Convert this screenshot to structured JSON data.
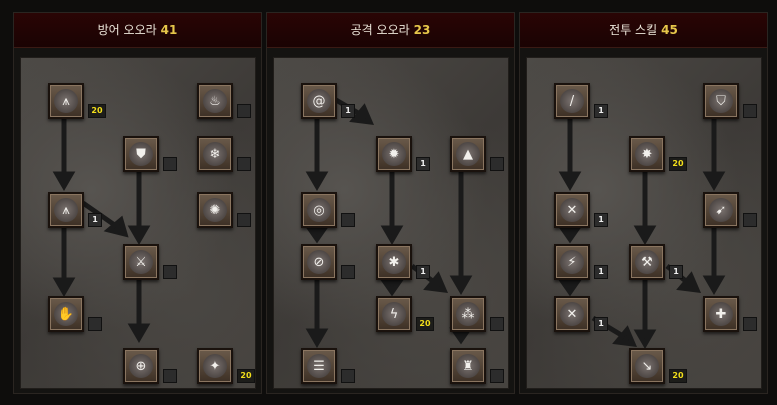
{
  "panels": [
    {
      "title": "방어 오오라",
      "points": "41",
      "nodes": [
        {
          "id": "d1",
          "icon": "claw-icon",
          "glyph": "⩚",
          "level": "20",
          "max": true
        },
        {
          "id": "d2",
          "icon": "wild-icon",
          "glyph": "♨",
          "level": "",
          "max": false
        },
        {
          "id": "d3",
          "icon": "shield-icon",
          "glyph": "⛊",
          "level": "",
          "max": false
        },
        {
          "id": "d4",
          "icon": "snowflake-icon",
          "glyph": "❄",
          "level": "",
          "max": false
        },
        {
          "id": "d5",
          "icon": "double-claw-icon",
          "glyph": "⩚",
          "level": "1",
          "max": false
        },
        {
          "id": "d6",
          "icon": "blade-icon",
          "glyph": "⚔",
          "level": "",
          "max": false
        },
        {
          "id": "d7",
          "icon": "swirl-icon",
          "glyph": "✺",
          "level": "",
          "max": false
        },
        {
          "id": "d8",
          "icon": "flame-hand-icon",
          "glyph": "✋",
          "level": "",
          "max": false
        },
        {
          "id": "d9",
          "icon": "target-icon",
          "glyph": "⊕",
          "level": "",
          "max": false
        },
        {
          "id": "d10",
          "icon": "compass-icon",
          "glyph": "✦",
          "level": "20",
          "max": true
        }
      ]
    },
    {
      "title": "공격 오오라",
      "points": "23",
      "nodes": [
        {
          "id": "o1",
          "icon": "spiral-icon",
          "glyph": "@",
          "level": "1",
          "max": false
        },
        {
          "id": "o2",
          "icon": "sun-blade-icon",
          "glyph": "✹",
          "level": "1",
          "max": false
        },
        {
          "id": "o3",
          "icon": "pyramid-icon",
          "glyph": "▲",
          "level": "",
          "max": false
        },
        {
          "id": "o4",
          "icon": "rings-icon",
          "glyph": "◎",
          "level": "",
          "max": false
        },
        {
          "id": "o5",
          "icon": "slash-circle-icon",
          "glyph": "⊘",
          "level": "",
          "max": false
        },
        {
          "id": "o6",
          "icon": "wheel-icon",
          "glyph": "✱",
          "level": "1",
          "max": false
        },
        {
          "id": "o7",
          "icon": "lightning-icon",
          "glyph": "ϟ",
          "level": "20",
          "max": true
        },
        {
          "id": "o8",
          "icon": "bubbles-icon",
          "glyph": "⁂",
          "level": "",
          "max": false
        },
        {
          "id": "o9",
          "icon": "stripes-icon",
          "glyph": "☰",
          "level": "",
          "max": false
        },
        {
          "id": "o10",
          "icon": "fang-icon",
          "glyph": "♜",
          "level": "",
          "max": false
        }
      ]
    },
    {
      "title": "전투 스킬",
      "points": "45",
      "nodes": [
        {
          "id": "c1",
          "icon": "sword-icon",
          "glyph": "/",
          "level": "1",
          "max": false
        },
        {
          "id": "c2",
          "icon": "heraldic-shield-icon",
          "glyph": "⛉",
          "level": "",
          "max": false
        },
        {
          "id": "c3",
          "icon": "burst-strike-icon",
          "glyph": "✸",
          "level": "20",
          "max": true
        },
        {
          "id": "c4",
          "icon": "crossed-swords-icon",
          "glyph": "✕",
          "level": "1",
          "max": false
        },
        {
          "id": "c5",
          "icon": "charge-icon",
          "glyph": "➹",
          "level": "",
          "max": false
        },
        {
          "id": "c6",
          "icon": "zeal-icon",
          "glyph": "⚡",
          "level": "1",
          "max": false
        },
        {
          "id": "c7",
          "icon": "hammer-icon",
          "glyph": "⚒",
          "level": "1",
          "max": false
        },
        {
          "id": "c8",
          "icon": "vengeance-icon",
          "glyph": "✕",
          "level": "1",
          "max": false
        },
        {
          "id": "c9",
          "icon": "holy-shield-icon",
          "glyph": "✚",
          "level": "",
          "max": false
        },
        {
          "id": "c10",
          "icon": "fist-of-heavens-icon",
          "glyph": "↘",
          "level": "20",
          "max": true
        }
      ]
    }
  ]
}
